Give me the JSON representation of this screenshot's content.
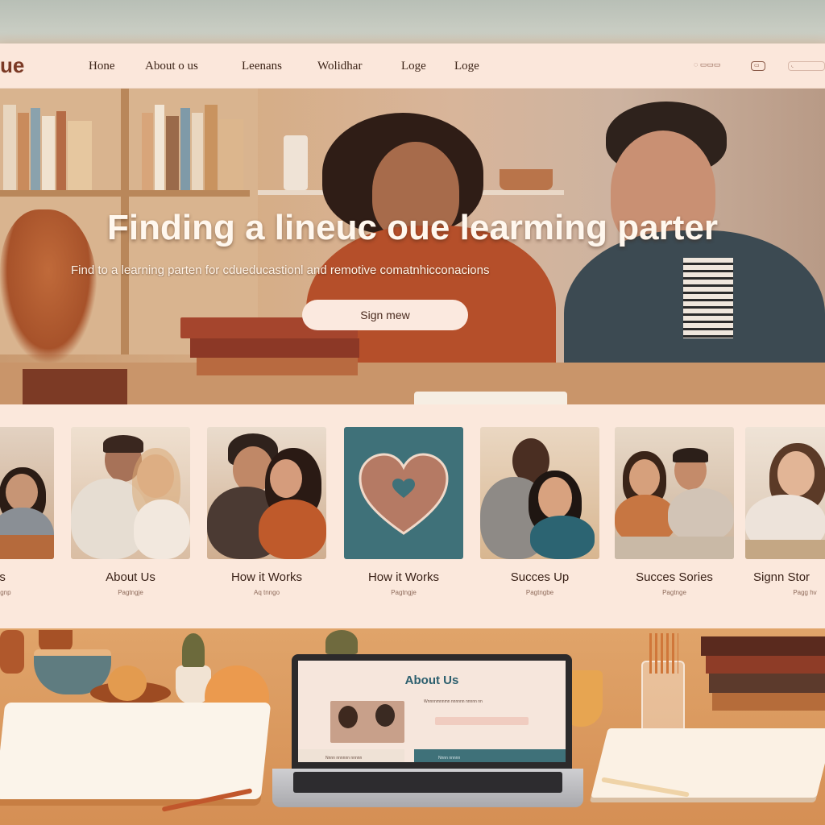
{
  "navbar": {
    "logo": "ue",
    "links": [
      "Hone",
      "About o us",
      "Leenans",
      "Wolidhar",
      "Loge",
      "Loge"
    ],
    "util1": "◌ ▭▭▭",
    "util2": "▭",
    "util3": "◟"
  },
  "hero": {
    "title": "Finding a lineuc oue learming parter",
    "subtitle": "Find to a learning parten for cdueducastionl and remotive comatnhicconacions",
    "cta_label": "Sign mew"
  },
  "cards": [
    {
      "title": "us",
      "sub": "Pagnp"
    },
    {
      "title": "About Us",
      "sub": "Pagtngje"
    },
    {
      "title": "How it Works",
      "sub": "Aq tnngo"
    },
    {
      "title": "How it Works",
      "sub": "Pagtngje"
    },
    {
      "title": "Succes Up",
      "sub": "Pagtngbe"
    },
    {
      "title": "Succes Sories",
      "sub": "Pagtnge"
    },
    {
      "title": "Signn Stor",
      "sub": "Pagg hv"
    }
  ],
  "laptop": {
    "title": "About Us",
    "text_line": "Wnnnnmnnmn nnnnnn nnnnn nn",
    "footer_left": "Nnnn nnnnnn nnnnn",
    "footer_right": "Nnnn nnnnn"
  },
  "colors": {
    "page_bg": "#fbe8dc",
    "accent_teal": "#3f7179",
    "heart": "#b57a64",
    "text_dark": "#3a2218"
  }
}
